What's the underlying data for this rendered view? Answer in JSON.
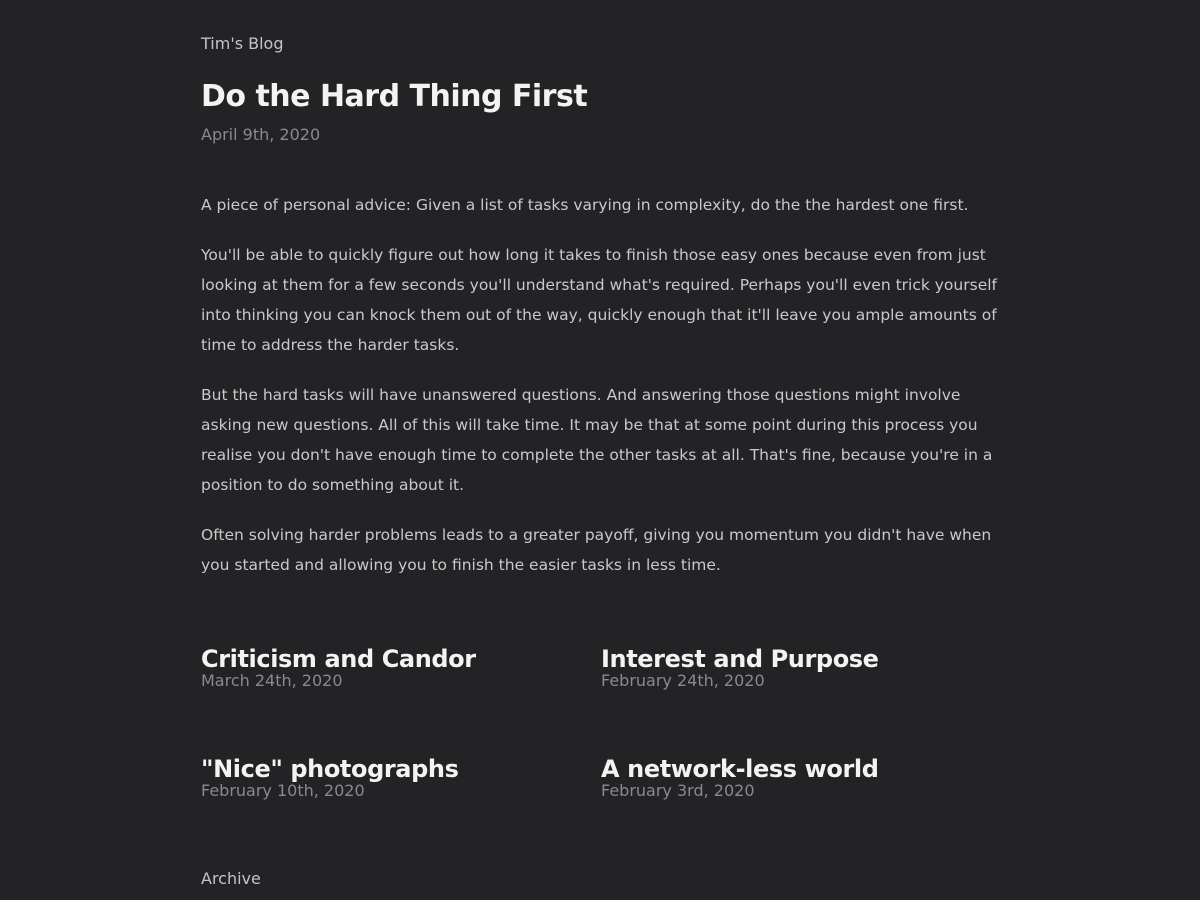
{
  "header": {
    "blog_name": "Tim's Blog"
  },
  "post": {
    "title": "Do the Hard Thing First",
    "date": "April 9th, 2020",
    "paragraphs": [
      "A piece of personal advice: Given a list of tasks varying in complexity, do the the hardest one first.",
      "You'll be able to quickly figure out how long it takes to finish those easy ones because even from just looking at them for a few seconds you'll understand what's required. Perhaps you'll even trick yourself into thinking you can knock them out of the way, quickly enough that it'll leave you ample amounts of time to address the harder tasks.",
      "But the hard tasks will have unanswered questions. And answering those questions might involve asking new questions. All of this will take time. It may be that at some point during this process you realise you don't have enough time to complete the other tasks at all. That's fine, because you're in a position to do something about it.",
      "Often solving harder problems leads to a greater payoff, giving you momentum you didn't have when you started and allowing you to finish the easier tasks in less time."
    ]
  },
  "related": [
    {
      "title": "Criticism and Candor",
      "date": "March 24th, 2020"
    },
    {
      "title": "Interest and Purpose",
      "date": "February 24th, 2020"
    },
    {
      "title": "\"Nice\" photographs",
      "date": "February 10th, 2020"
    },
    {
      "title": "A network-less world",
      "date": "February 3rd, 2020"
    }
  ],
  "footer": {
    "archive_label": "Archive"
  },
  "colors": {
    "background": "#232325",
    "heading": "#f3f3f4",
    "body_text": "#c9c9cb",
    "muted": "#8a8a8d"
  }
}
